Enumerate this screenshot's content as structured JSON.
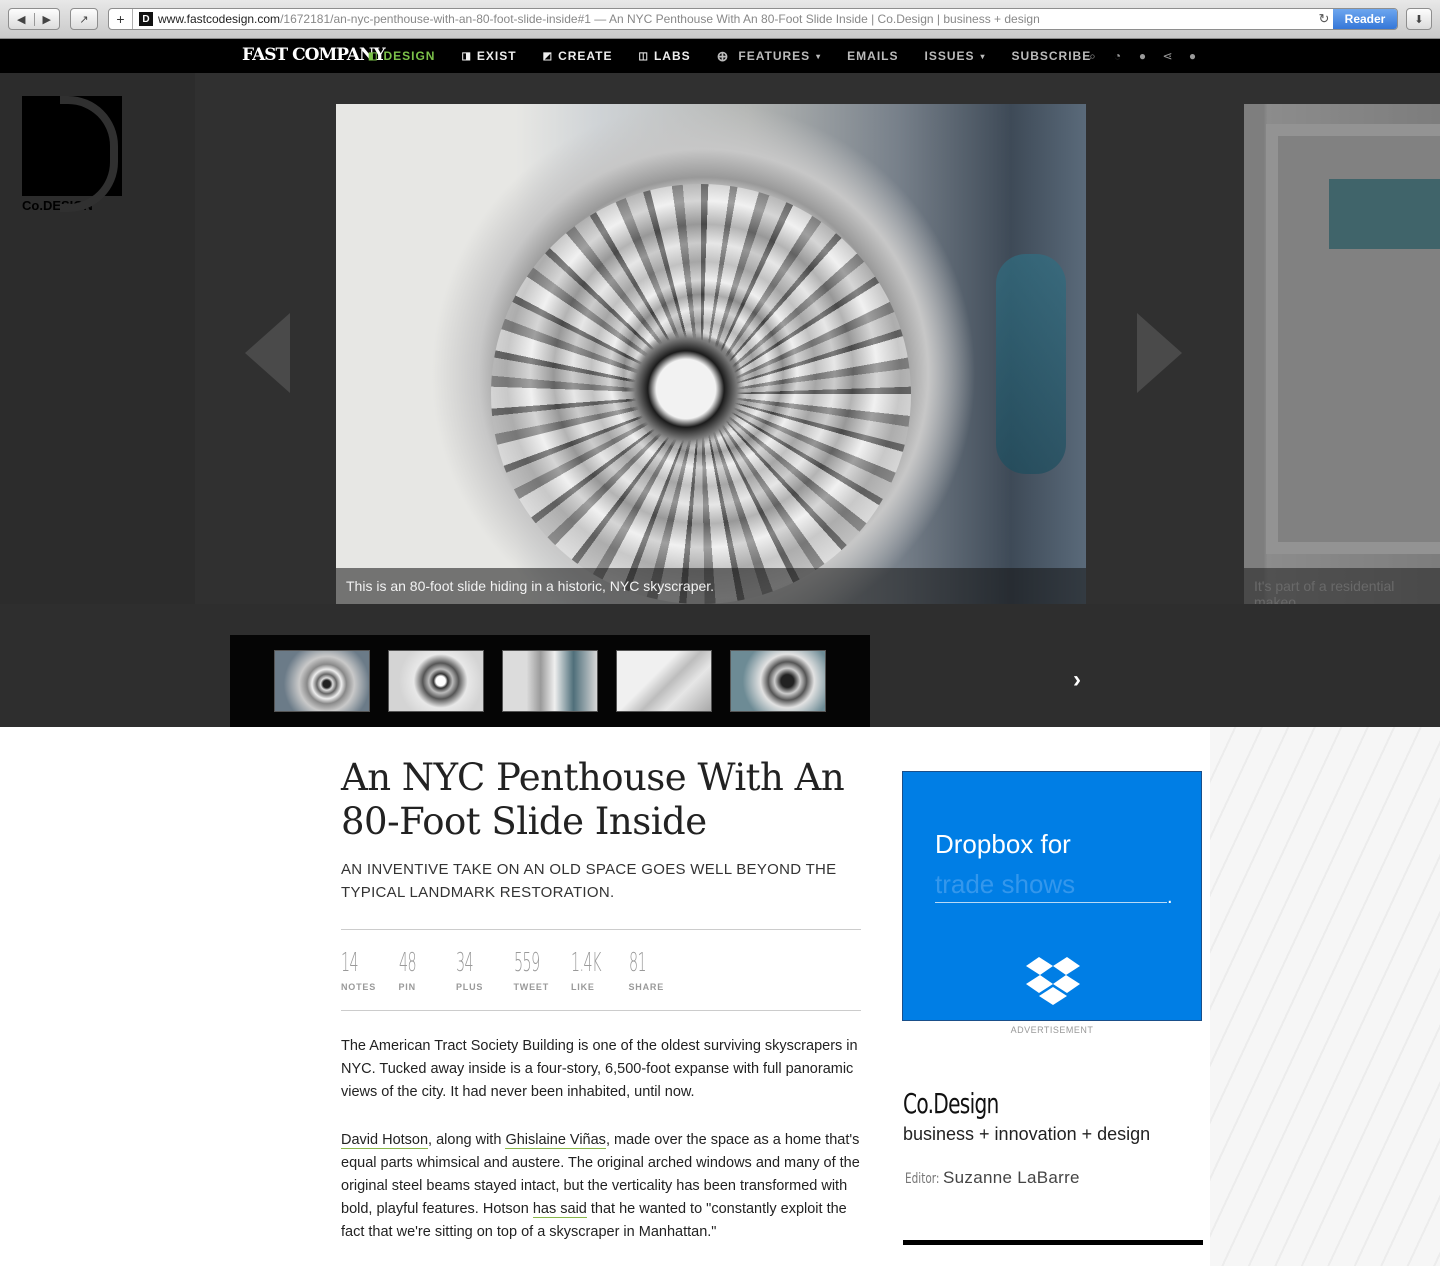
{
  "browser": {
    "back_icon": "◀",
    "forward_icon": "▶",
    "share_icon": "↗",
    "add_tab": "+",
    "favicon": "D",
    "url_domain": "www.fastcodesign.com",
    "url_path": "/1672181/an-nyc-penthouse-with-an-80-foot-slide-inside#1",
    "url_separator": " — ",
    "page_title": "An NYC Penthouse With An 80-Foot Slide Inside | Co.Design | business + design",
    "reload_icon": "↻",
    "reader_label": "Reader",
    "download_icon": "⬇"
  },
  "site_nav": {
    "logo": "FAST COMPANY",
    "items": [
      {
        "label": "DESIGN",
        "icon": "◧",
        "active": true
      },
      {
        "label": "EXIST",
        "icon": "◨"
      },
      {
        "label": "CREATE",
        "icon": "◩"
      },
      {
        "label": "LABS",
        "icon": "◫"
      },
      {
        "label": "FEATURES",
        "icon": "⊕",
        "caret": "▾"
      },
      {
        "label": "EMAILS"
      },
      {
        "label": "ISSUES",
        "caret": "▾"
      },
      {
        "label": "SUBSCRIBE"
      }
    ],
    "icons": [
      "search-icon",
      "rss-icon",
      "globe-icon",
      "share-icon",
      "user-icon"
    ],
    "icon_glyphs": [
      "⌕",
      "◔",
      "●",
      "⋖",
      "●"
    ]
  },
  "gallery": {
    "brand": "Co.DESIGN",
    "main_caption": "This is an 80-foot slide hiding in a historic, NYC skyscraper.",
    "next_caption": "It's part of a residential makeo",
    "thumb_next_icon": "›",
    "thumb_count": 5
  },
  "article": {
    "headline": "An NYC Penthouse With An 80-Foot Slide Inside",
    "dek": "AN INVENTIVE TAKE ON AN OLD SPACE GOES WELL BEYOND THE TYPICAL LANDMARK RESTORATION.",
    "shares": [
      {
        "count": "14",
        "label": "NOTES"
      },
      {
        "count": "48",
        "label": "PIN"
      },
      {
        "count": "34",
        "label": "PLUS"
      },
      {
        "count": "559",
        "label": "TWEET"
      },
      {
        "count": "1.4K",
        "label": "LIKE"
      },
      {
        "count": "81",
        "label": "SHARE"
      }
    ],
    "p1": "The American Tract Society Building is one of the oldest surviving skyscrapers in NYC. Tucked away inside is a four-story, 6,500-foot expanse with full panoramic views of the city. It had never been inhabited, until now.",
    "p2": {
      "link1": "David Hotson",
      "t1": ", along with ",
      "link2": "Ghislaine Viñas",
      "t2": ", made over the space as a home that's equal parts whimsical and austere. The original arched windows and many of the original steel beams stayed intact, but the verticality has been transformed with bold, playful features. Hotson ",
      "link3": "has said",
      "t3": " that he wanted to \"constantly exploit the fact that we're sitting on top of a skyscraper in Manhattan.\""
    }
  },
  "sidebar": {
    "ad_line1": "Dropbox for",
    "ad_line2": "trade shows",
    "ad_dot": ".",
    "ad_label": "ADVERTISEMENT",
    "title": "Co.Design",
    "tagline": "business + innovation + design",
    "editor_label": "Editor:",
    "editor_name": "Suzanne LaBarre"
  },
  "colors": {
    "accent_green": "#7cc24a",
    "dropbox_blue": "#007ee5",
    "nav_bg": "#000000",
    "gallery_bg": "#2e2e2e"
  }
}
